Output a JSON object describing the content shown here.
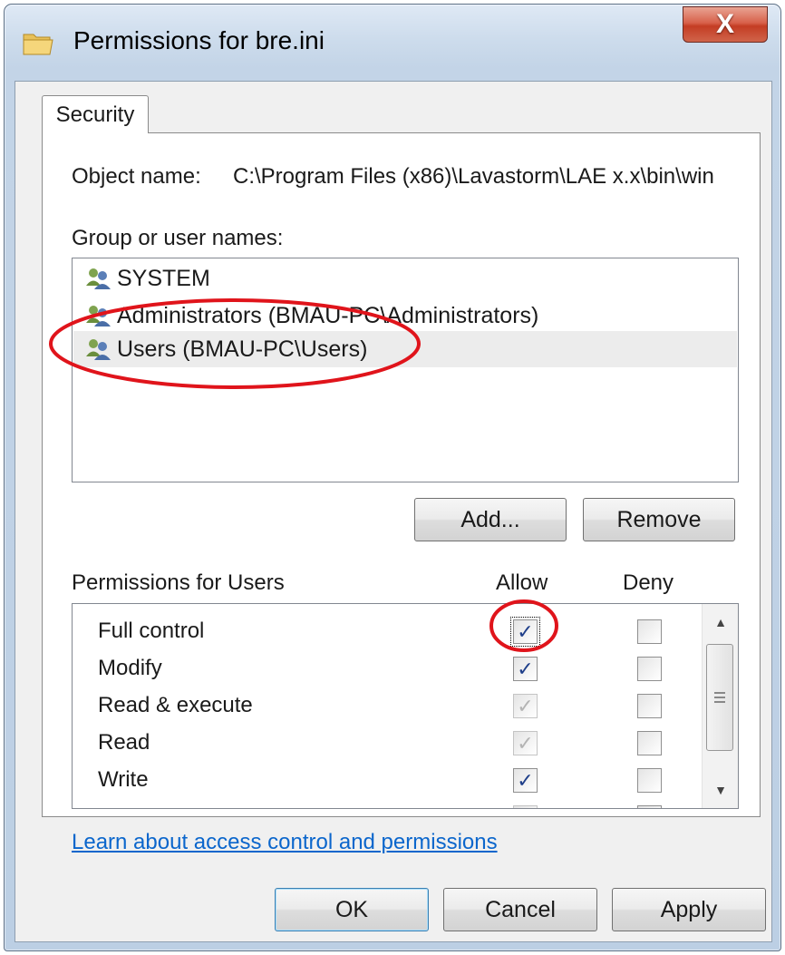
{
  "window": {
    "title": "Permissions for bre.ini",
    "close_label": "X",
    "icons": {
      "window": "folder-icon",
      "user": "users-group-icon"
    }
  },
  "tab": {
    "label": "Security"
  },
  "object": {
    "label": "Object name:",
    "value": "C:\\Program Files (x86)\\Lavastorm\\LAE x.x\\bin\\win"
  },
  "groups": {
    "label": "Group or user names:",
    "items": [
      {
        "label": "SYSTEM",
        "selected": false
      },
      {
        "label": "Administrators (BMAU-PC\\Administrators)",
        "selected": false
      },
      {
        "label": "Users (BMAU-PC\\Users)",
        "selected": true
      }
    ],
    "add_button": "Add...",
    "remove_button": "Remove"
  },
  "permissions": {
    "header": "Permissions for Users",
    "allow_header": "Allow",
    "deny_header": "Deny",
    "rows": [
      {
        "name": "Full control",
        "allow": "checked",
        "deny": "unchecked"
      },
      {
        "name": "Modify",
        "allow": "checked",
        "deny": "unchecked"
      },
      {
        "name": "Read & execute",
        "allow": "inherited",
        "deny": "unchecked"
      },
      {
        "name": "Read",
        "allow": "inherited",
        "deny": "unchecked"
      },
      {
        "name": "Write",
        "allow": "checked",
        "deny": "unchecked"
      }
    ]
  },
  "link": {
    "text": "Learn about access control and permissions"
  },
  "buttons": {
    "ok": "OK",
    "cancel": "Cancel",
    "apply": "Apply"
  },
  "annotation": {
    "color": "#e0141b"
  }
}
